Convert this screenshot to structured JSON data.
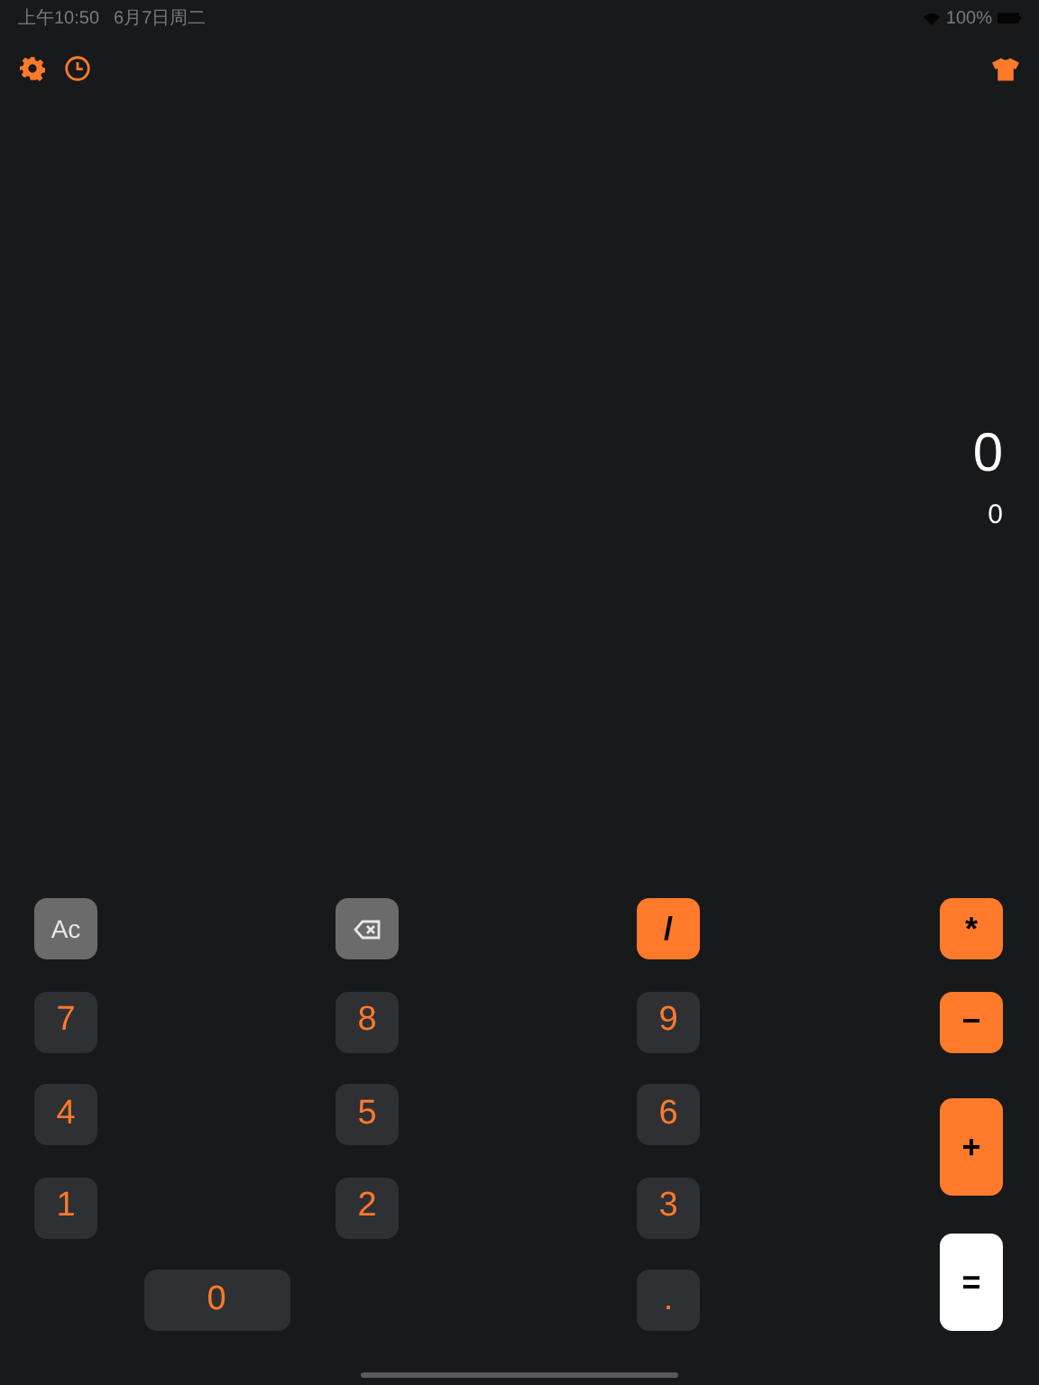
{
  "status_bar": {
    "time": "上午10:50",
    "date": "6月7日周二",
    "battery": "100%"
  },
  "display": {
    "result": "0",
    "expression": "0"
  },
  "keys": [
    {
      "label": "Ac",
      "kind": "clear"
    },
    {
      "kind": "backspace"
    },
    {
      "label": "/",
      "kind": "operator"
    },
    {
      "label": "*",
      "kind": "operator"
    },
    {
      "label": "7",
      "kind": "digit"
    },
    {
      "label": "8",
      "kind": "digit"
    },
    {
      "label": "9",
      "kind": "digit"
    },
    {
      "label": "−",
      "kind": "operator"
    },
    {
      "label": "4",
      "kind": "digit"
    },
    {
      "label": "5",
      "kind": "digit"
    },
    {
      "label": "6",
      "kind": "digit"
    },
    {
      "label": "+",
      "kind": "operator"
    },
    {
      "label": "1",
      "kind": "digit"
    },
    {
      "label": "2",
      "kind": "digit"
    },
    {
      "label": "3",
      "kind": "digit"
    },
    {
      "label": "=",
      "kind": "equals"
    },
    {
      "label": "0",
      "kind": "digit"
    },
    {
      "label": ".",
      "kind": "digit"
    }
  ]
}
